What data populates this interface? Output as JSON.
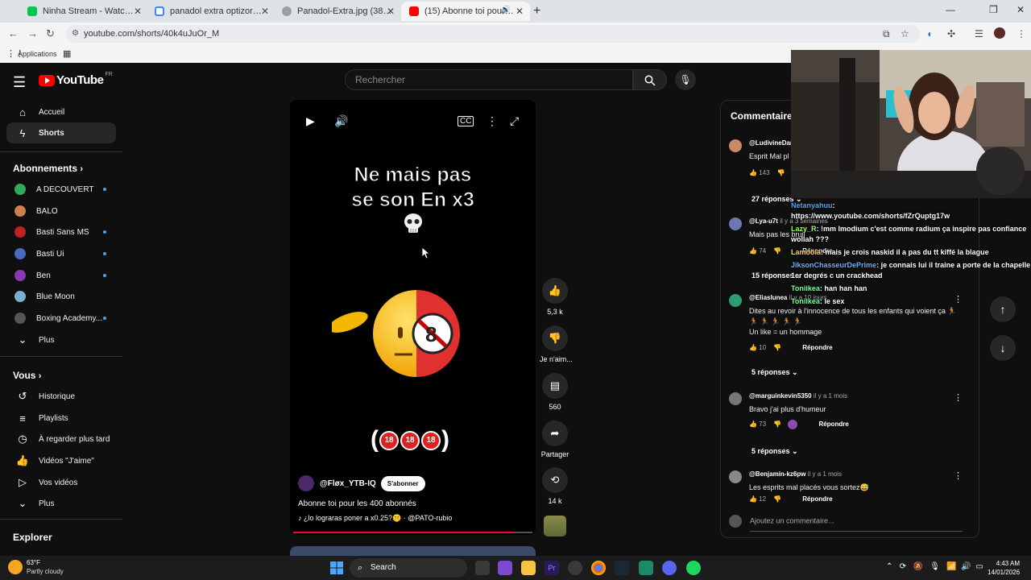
{
  "browser": {
    "tabs": [
      {
        "label": "Ninha Stream - Watch Live on K",
        "favcolor": "#00c853"
      },
      {
        "label": "panadol extra optizorb - Reche",
        "favcolor": "#4285f4"
      },
      {
        "label": "Panadol-Extra.jpg (380×463)",
        "favcolor": "#9aa0a6"
      },
      {
        "label": "(15) Abonne toi pour les 40",
        "favcolor": "#ff0000"
      }
    ],
    "url": "youtube.com/shorts/40k4uJuOr_M",
    "bookmarks_label": "Applications"
  },
  "youtube": {
    "logo_text": "YouTube",
    "logo_region": "FR",
    "search_placeholder": "Rechercher",
    "sidebar": {
      "main": [
        {
          "label": "Accueil",
          "icon": "home-icon"
        },
        {
          "label": "Shorts",
          "icon": "shorts-icon"
        }
      ],
      "subs_header": "Abonnements",
      "subs": [
        {
          "label": "A DECOUVERT",
          "color": "#2eaa5a",
          "dot": true
        },
        {
          "label": "BALO",
          "color": "#c9804a",
          "dot": false
        },
        {
          "label": "Basti Sans MS",
          "color": "#c02020",
          "dot": true
        },
        {
          "label": "Basti Ui",
          "color": "#4a6ac0",
          "dot": true
        },
        {
          "label": "Ben",
          "color": "#8a3ab0",
          "dot": true
        },
        {
          "label": "Blue Moon",
          "color": "#7ab0d0",
          "dot": false
        },
        {
          "label": "Boxing Academy...",
          "color": "#555555",
          "dot": true
        }
      ],
      "subs_more": "Plus",
      "you_header": "Vous",
      "you": [
        {
          "label": "Historique",
          "icon": "history-icon"
        },
        {
          "label": "Playlists",
          "icon": "playlist-icon"
        },
        {
          "label": "À regarder plus tard",
          "icon": "watch-later-icon"
        },
        {
          "label": "Vidéos \"J'aime\"",
          "icon": "like-icon"
        },
        {
          "label": "Vos vidéos",
          "icon": "your-videos-icon"
        }
      ],
      "you_more": "Plus",
      "explore_header": "Explorer"
    },
    "short": {
      "caption_line1": "Ne mais pas",
      "caption_line2": "se son En x3",
      "channel": "@Fløx_YTB-IQ",
      "subscribe": "S'abonner",
      "title": "Abonne toi pour les 400 abonnés",
      "music": "♪ ¿lo lograras poner a x0.25?🤫 · @PATO-rubio",
      "badge_text": "18",
      "progress": 0.92
    },
    "actions": {
      "likes": "5,3 k",
      "dislike": "Je n'aim...",
      "comments": "560",
      "share": "Partager",
      "remix": "14 k"
    },
    "comments": {
      "title": "Commentaire",
      "items": [
        {
          "user": "@LudivineDar",
          "time": "",
          "text": "Esprit Mal pl",
          "likes": "143",
          "reply": "",
          "replies": "27 réponses",
          "color": "#c98a6a"
        },
        {
          "user": "@Lya-u7t",
          "time": "il y a 3 semaines",
          "text": "Mais pas les bruil",
          "likes": "74",
          "reply": "Répondre",
          "replies": "15 réponses",
          "color": "#6a7ab0"
        },
        {
          "user": "@Eliaslunea",
          "time": "il y a 10 jours",
          "text": "Dites au revoir à l'innocence de tous les enfants qui voient ça 🏃 🏃 🏃 🏃 🏃 🏃",
          "text2": "Un like = un hommage",
          "likes": "10",
          "reply": "Répondre",
          "replies": "5 réponses",
          "color": "#2aa070"
        },
        {
          "user": "@marguinkevin5350",
          "time": "il y a 1 mois",
          "text": "Bravo j'ai plus d'humeur",
          "likes": "73",
          "reply": "Répondre",
          "replies": "5 réponses",
          "color": "#777777"
        },
        {
          "user": "@Benjamin-kz6pw",
          "time": "il y a 1 mois",
          "text": "Les esprits mal placés vous sortez😅",
          "likes": "12",
          "reply": "Répondre",
          "replies": "",
          "color": "#888888"
        }
      ],
      "add_placeholder": "Ajoutez un commentaire..."
    }
  },
  "stream_chat": [
    {
      "user": "Netanyahuu",
      "color": "#4fa3ff",
      "msg": "https://www.youtube.com/shorts/fZrQuptg17w"
    },
    {
      "user": "Lazy_R",
      "color": "#9bff6a",
      "msg": "!mm Imodium c'est comme radium ça inspire pas confiance wollah ???"
    },
    {
      "user": "Lamoola",
      "color": "#ffd24a",
      "msg": "mais je crois naskid il a pas du tt kiffé la blague"
    },
    {
      "user": "JiksonChasseurDePrime",
      "color": "#6ab0ff",
      "msg": "je connais lui il traine a porte de la chapelle 1er degrés c un crackhead"
    },
    {
      "user": "Toniikea",
      "color": "#7dff9a",
      "msg": "han han han"
    },
    {
      "user": "Toniikea",
      "color": "#7dff9a",
      "msg": "le sex"
    }
  ],
  "taskbar": {
    "temp": "63°F",
    "weather": "Partly cloudy",
    "search": "Search",
    "time": "4:43 AM",
    "date": "14/01/2026"
  }
}
